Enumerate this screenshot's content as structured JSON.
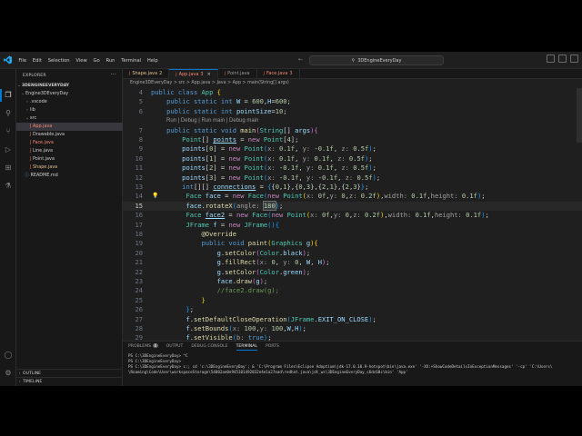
{
  "window": {
    "menus": [
      "File",
      "Edit",
      "Selection",
      "View",
      "Go",
      "Run",
      "Terminal",
      "Help"
    ],
    "search_text": "3DEngineEveryDay"
  },
  "sidebar": {
    "title": "EXPLORER",
    "root": "3DENGINEEVERYDAY",
    "items": [
      {
        "label": "Engine3DEveryDay",
        "badge": ""
      },
      {
        "label": ".vscode",
        "badge": ""
      },
      {
        "label": "lib",
        "badge": ""
      },
      {
        "label": "src",
        "badge": ""
      },
      {
        "label": "App.java",
        "badge": "3"
      },
      {
        "label": "Drawable.java",
        "badge": ""
      },
      {
        "label": "Face.java",
        "badge": "3"
      },
      {
        "label": "Line.java",
        "badge": ""
      },
      {
        "label": "Point.java",
        "badge": ""
      },
      {
        "label": "Shape.java",
        "badge": "2"
      },
      {
        "label": "README.md",
        "badge": ""
      }
    ],
    "outline": "OUTLINE",
    "timeline": "TIMELINE"
  },
  "tabs": [
    {
      "label": "Shape.java",
      "badge": "2"
    },
    {
      "label": "App.java",
      "badge": "3"
    },
    {
      "label": "Point.java",
      "badge": ""
    },
    {
      "label": "Face.java",
      "badge": "3"
    }
  ],
  "breadcrumb": "Engine3DEveryDay > src > App.java > Java > App > main(String[] args)",
  "editor": {
    "codelens": "Run | Debug | Run main | Debug main",
    "line_numbers": [
      "4",
      "5",
      "6",
      "",
      "7",
      "8",
      "9",
      "10",
      "11",
      "12",
      "13",
      "14",
      "15",
      "16",
      "17",
      "18",
      "19",
      "20",
      "21",
      "22",
      "23",
      "24",
      "25",
      "26",
      "27",
      "28",
      "29"
    ]
  },
  "panel": {
    "tabs": [
      "PROBLEMS",
      "OUTPUT",
      "DEBUG CONSOLE",
      "TERMINAL",
      "PORTS"
    ],
    "problems_count": "6",
    "terminal_lines": [
      "PS C:\\3DEngineEveryDay> ^C",
      "PS C:\\3DEngineEveryDay>",
      "PS C:\\3DEngineEveryDay> c:; cd 'c:\\3DEngineEveryDay'; & 'C:\\Program Files\\Eclipse Adoptium\\jdk-17.0.10.9-hotspot\\bin\\java.exe' '-XX:+ShowCodeDetailsInExceptionMessages' '-cp' 'C:\\Users\\",
      "\\Roaming\\Code\\User\\workspaceStorage\\54002ae0e945101492832e4e1a27ead\\redhat.java\\jdt_ws\\3DEngineEveryDay_c6dc60c\\bin' 'App'"
    ]
  },
  "colors": {
    "accent": "#0078d4",
    "keyword": "#569cd6",
    "type": "#4ec9b0",
    "number": "#b5cea8"
  }
}
